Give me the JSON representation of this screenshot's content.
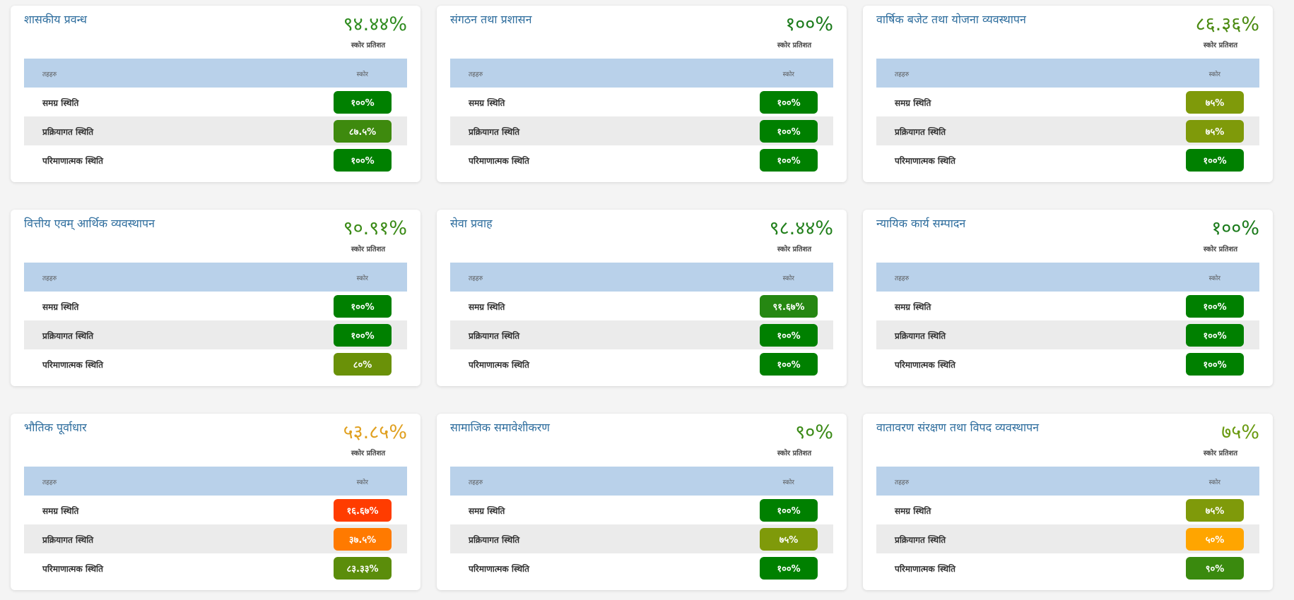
{
  "score_label": "स्कोर प्रतिशत",
  "col_indicator": "तहहरु",
  "col_score": "स्कोर",
  "cards": [
    {
      "title": "शासकीय प्रवन्ध",
      "score": "९४.४४%",
      "score_color": "#2e8b1f",
      "rows": [
        {
          "label": "समग्र स्थिति",
          "value": "१००%",
          "color": "#008000"
        },
        {
          "label": "प्रक्रियागत स्थिति",
          "value": "८७.५%",
          "color": "#3e8a0e"
        },
        {
          "label": "परिमाणात्मक स्थिति",
          "value": "१००%",
          "color": "#008000"
        }
      ]
    },
    {
      "title": "संगठन तथा प्रशासन",
      "score": "१००%",
      "score_color": "#1a7a1a",
      "rows": [
        {
          "label": "समग्र स्थिति",
          "value": "१००%",
          "color": "#008000"
        },
        {
          "label": "प्रक्रियागत स्थिति",
          "value": "१००%",
          "color": "#008000"
        },
        {
          "label": "परिमाणात्मक स्थिति",
          "value": "१००%",
          "color": "#008000"
        }
      ]
    },
    {
      "title": "वार्षिक बजेट तथा योजना व्यवस्थापन",
      "score": "८६.३६%",
      "score_color": "#4a8a10",
      "rows": [
        {
          "label": "समग्र स्थिति",
          "value": "७५%",
          "color": "#7f9a0a"
        },
        {
          "label": "प्रक्रियागत स्थिति",
          "value": "७५%",
          "color": "#7f9a0a"
        },
        {
          "label": "परिमाणात्मक स्थिति",
          "value": "१००%",
          "color": "#008000"
        }
      ]
    },
    {
      "title": "वित्तीय एवम् आर्थिक व्यवस्थापन",
      "score": "९०.९१%",
      "score_color": "#3a8a16",
      "rows": [
        {
          "label": "समग्र स्थिति",
          "value": "१००%",
          "color": "#008000"
        },
        {
          "label": "प्रक्रियागत स्थिति",
          "value": "१००%",
          "color": "#008000"
        },
        {
          "label": "परिमाणात्मक स्थिति",
          "value": "८०%",
          "color": "#6a9108"
        }
      ]
    },
    {
      "title": "सेवा प्रवाह",
      "score": "९८.४४%",
      "score_color": "#22801c",
      "rows": [
        {
          "label": "समग्र स्थिति",
          "value": "९१.६७%",
          "color": "#268712"
        },
        {
          "label": "प्रक्रियागत स्थिति",
          "value": "१००%",
          "color": "#008000"
        },
        {
          "label": "परिमाणात्मक स्थिति",
          "value": "१००%",
          "color": "#008000"
        }
      ]
    },
    {
      "title": "न्यायिक कार्य सम्पादन",
      "score": "१००%",
      "score_color": "#1a7a1a",
      "rows": [
        {
          "label": "समग्र स्थिति",
          "value": "१००%",
          "color": "#008000"
        },
        {
          "label": "प्रक्रियागत स्थिति",
          "value": "१००%",
          "color": "#008000"
        },
        {
          "label": "परिमाणात्मक स्थिति",
          "value": "१००%",
          "color": "#008000"
        }
      ]
    },
    {
      "title": "भौतिक पूर्वाधार",
      "score": "५३.८५%",
      "score_color": "#e0a020",
      "rows": [
        {
          "label": "समग्र स्थिति",
          "value": "१६.६७%",
          "color": "#ff3c00"
        },
        {
          "label": "प्रक्रियागत स्थिति",
          "value": "३७.५%",
          "color": "#ff7a00"
        },
        {
          "label": "परिमाणात्मक स्थिति",
          "value": "८३.३३%",
          "color": "#5b8d0b"
        }
      ]
    },
    {
      "title": "सामाजिक समावेशीकरण",
      "score": "९०%",
      "score_color": "#3a8a16",
      "rows": [
        {
          "label": "समग्र स्थिति",
          "value": "१००%",
          "color": "#008000"
        },
        {
          "label": "प्रक्रियागत स्थिति",
          "value": "७५%",
          "color": "#7f9a0a"
        },
        {
          "label": "परिमाणात्मक स्थिति",
          "value": "१००%",
          "color": "#008000"
        }
      ]
    },
    {
      "title": "वातावरण संरक्षण तथा विपद व्यवस्थापन",
      "score": "७५%",
      "score_color": "#6a9a10",
      "rows": [
        {
          "label": "समग्र स्थिति",
          "value": "७५%",
          "color": "#7f9a0a"
        },
        {
          "label": "प्रक्रियागत स्थिति",
          "value": "५०%",
          "color": "#ffa500"
        },
        {
          "label": "परिमाणात्मक स्थिति",
          "value": "९०%",
          "color": "#3a8a0e"
        }
      ]
    }
  ]
}
